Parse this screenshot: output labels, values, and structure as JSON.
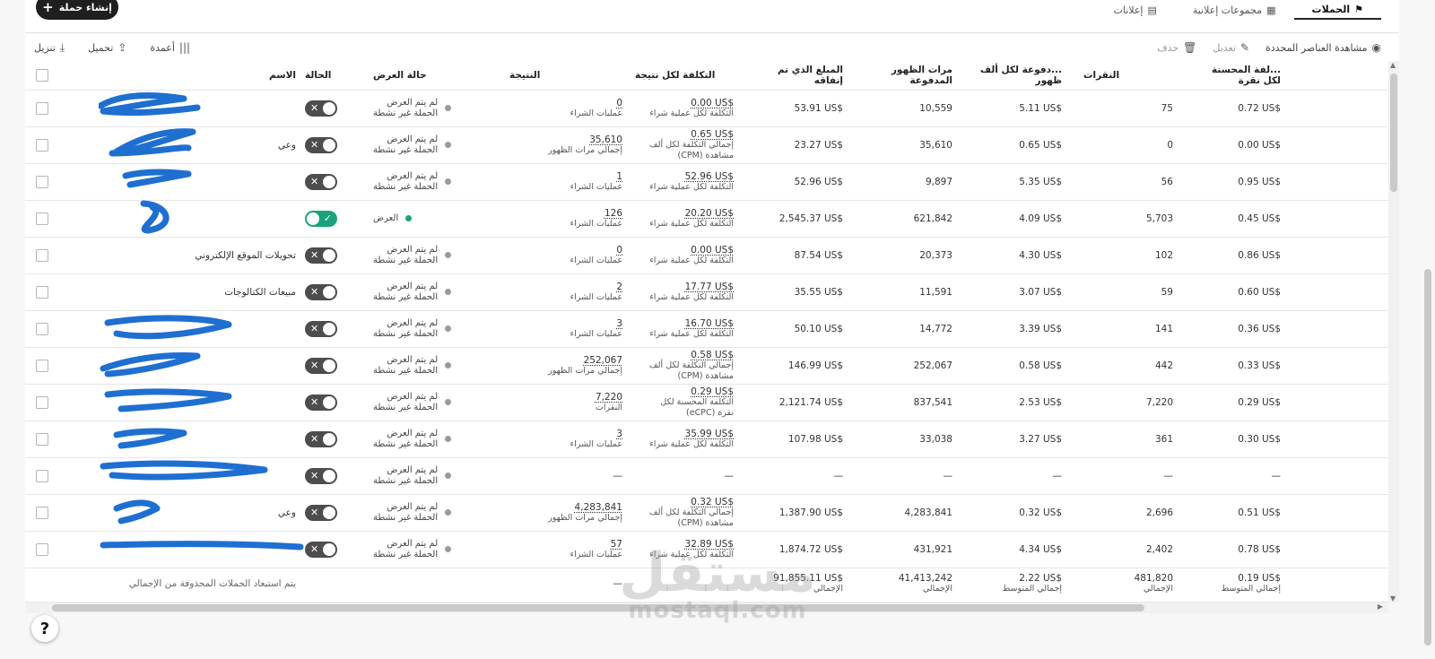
{
  "topbar": {
    "create_button": "إنشاء حملة",
    "tabs": [
      {
        "label": "الحملات",
        "icon": "campaigns-icon",
        "active": true
      },
      {
        "label": "مجموعات إعلانية",
        "icon": "adsets-icon",
        "active": false
      },
      {
        "label": "إعلانات",
        "icon": "ads-icon",
        "active": false
      }
    ]
  },
  "toolbar": {
    "view_selected": "مشاهدة العناصر المحددة",
    "edit": "تعديل",
    "delete": "حذف",
    "columns": "أعمدة",
    "upload": "تحميل",
    "download": "تنزيل"
  },
  "table": {
    "headers": {
      "name": "الاسم",
      "status": "الحالة",
      "display_status": "حالة العرض",
      "result": "النتيجة",
      "cost_per_result": "التكلفة لكل نتيجة",
      "amount_spent": "المبلغ الذي تم إنفاقه",
      "paid_impressions": "مرات الظهور المدفوعة",
      "cpm": "...دفوعة لكل ألف ظهور",
      "clicks": "النقرات",
      "cpc": "...لفة المحسنة لكل نقرة"
    },
    "rows": [
      {
        "name": "",
        "on": false,
        "disp": "لم يتم العرض|الحملة غير نشطة",
        "result": "0",
        "result_sub": "عمليات الشراء",
        "cpr": "0.00 US$",
        "cpr_sub": "التكلفة لكل عملية شراء",
        "spent": "53.91 US$",
        "impr": "10,559",
        "cpm": "5.11 US$",
        "clicks": "75",
        "cpc": "0.72 US$"
      },
      {
        "name": "وعي",
        "on": false,
        "disp": "لم يتم العرض|الحملة غير نشطة",
        "result": "35,610",
        "result_sub": "إجمالي مرات الظهور",
        "cpr": "0.65 US$",
        "cpr_sub": "إجمالي التكلفة لكل ألف|مشاهدة (CPM)",
        "spent": "23.27 US$",
        "impr": "35,610",
        "cpm": "0.65 US$",
        "clicks": "0",
        "cpc": "0.00 US$"
      },
      {
        "name": "",
        "on": false,
        "disp": "لم يتم العرض|الحملة غير نشطة",
        "result": "1",
        "result_sub": "عمليات الشراء",
        "cpr": "52.96 US$",
        "cpr_sub": "التكلفة لكل عملية شراء",
        "spent": "52.96 US$",
        "impr": "9,897",
        "cpm": "5.35 US$",
        "clicks": "56",
        "cpc": "0.95 US$"
      },
      {
        "name": "",
        "on": true,
        "disp": "العرض",
        "result": "126",
        "result_sub": "عمليات الشراء",
        "cpr": "20.20 US$",
        "cpr_sub": "التكلفة لكل عملية شراء",
        "spent": "2,545.37 US$",
        "impr": "621,842",
        "cpm": "4.09 US$",
        "clicks": "5,703",
        "cpc": "0.45 US$"
      },
      {
        "name": "تحويلات الموقع الإلكتروني",
        "on": false,
        "disp": "لم يتم العرض|الحملة غير نشطة",
        "result": "0",
        "result_sub": "عمليات الشراء",
        "cpr": "0.00 US$",
        "cpr_sub": "التكلفة لكل عملية شراء",
        "spent": "87.54 US$",
        "impr": "20,373",
        "cpm": "4.30 US$",
        "clicks": "102",
        "cpc": "0.86 US$"
      },
      {
        "name": "مبيعات الكتالوجات",
        "on": false,
        "disp": "لم يتم العرض|الحملة غير نشطة",
        "result": "2",
        "result_sub": "عمليات الشراء",
        "cpr": "17.77 US$",
        "cpr_sub": "التكلفة لكل عملية شراء",
        "spent": "35.55 US$",
        "impr": "11,591",
        "cpm": "3.07 US$",
        "clicks": "59",
        "cpc": "0.60 US$"
      },
      {
        "name": "",
        "on": false,
        "disp": "لم يتم العرض|الحملة غير نشطة",
        "result": "3",
        "result_sub": "عمليات الشراء",
        "cpr": "16.70 US$",
        "cpr_sub": "التكلفة لكل عملية شراء",
        "spent": "50.10 US$",
        "impr": "14,772",
        "cpm": "3.39 US$",
        "clicks": "141",
        "cpc": "0.36 US$"
      },
      {
        "name": "",
        "on": false,
        "disp": "لم يتم العرض|الحملة غير نشطة",
        "result": "252,067",
        "result_sub": "إجمالي مرات الظهور",
        "cpr": "0.58 US$",
        "cpr_sub": "إجمالي التكلفة لكل ألف|مشاهدة (CPM)",
        "spent": "146.99 US$",
        "impr": "252,067",
        "cpm": "0.58 US$",
        "clicks": "442",
        "cpc": "0.33 US$"
      },
      {
        "name": "",
        "on": false,
        "disp": "لم يتم العرض|الحملة غير نشطة",
        "result": "7,220",
        "result_sub": "النقرات",
        "cpr": "0.29 US$",
        "cpr_sub": "التكلفة المحسنة لكل|نقرة (eCPC)",
        "spent": "2,121.74 US$",
        "impr": "837,541",
        "cpm": "2.53 US$",
        "clicks": "7,220",
        "cpc": "0.29 US$"
      },
      {
        "name": "",
        "on": false,
        "disp": "لم يتم العرض|الحملة غير نشطة",
        "result": "3",
        "result_sub": "عمليات الشراء",
        "cpr": "35.99 US$",
        "cpr_sub": "التكلفة لكل عملية شراء",
        "spent": "107.98 US$",
        "impr": "33,038",
        "cpm": "3.27 US$",
        "clicks": "361",
        "cpc": "0.30 US$"
      },
      {
        "name": "",
        "on": false,
        "disp": "لم يتم العرض|الحملة غير نشطة",
        "result": "—",
        "result_sub": "",
        "cpr": "—",
        "cpr_sub": "",
        "spent": "—",
        "impr": "—",
        "cpm": "—",
        "clicks": "—",
        "cpc": "—"
      },
      {
        "name": "وعي",
        "on": false,
        "disp": "لم يتم العرض|الحملة غير نشطة",
        "result": "4,283,841",
        "result_sub": "إجمالي مرات الظهور",
        "cpr": "0.32 US$",
        "cpr_sub": "إجمالي التكلفة لكل ألف|مشاهدة (CPM)",
        "spent": "1,387.90 US$",
        "impr": "4,283,841",
        "cpm": "0.32 US$",
        "clicks": "2,696",
        "cpc": "0.51 US$"
      },
      {
        "name": "",
        "on": false,
        "disp": "لم يتم العرض|الحملة غير نشطة",
        "result": "57",
        "result_sub": "عمليات الشراء",
        "cpr": "32.89 US$",
        "cpr_sub": "التكلفة لكل عملية شراء",
        "spent": "1,874.72 US$",
        "impr": "431,921",
        "cpm": "4.34 US$",
        "clicks": "2,402",
        "cpc": "0.78 US$"
      }
    ],
    "footer": {
      "note": "يتم استبعاد الحملات المحذوفة من الإجمالي",
      "result": "—",
      "spent": "91,855.11 US$",
      "spent_sub": "الإجمالي",
      "impr": "41,413,242",
      "impr_sub": "الإجمالي",
      "cpm": "2.22 US$",
      "cpm_sub": "إجمالي المتوسط",
      "clicks": "481,820",
      "clicks_sub": "الإجمالي",
      "cpc": "0.19 US$",
      "cpc_sub": "إجمالي المتوسط"
    }
  },
  "help_icon": "?",
  "watermark": {
    "ar": "مستقل",
    "en": "mostaql.com"
  },
  "colors": {
    "toggle_on": "#1aa37a",
    "toggle_off": "#4d4d4d",
    "redaction": "#1f6fd1",
    "dark_button": "#1f1f1f"
  }
}
